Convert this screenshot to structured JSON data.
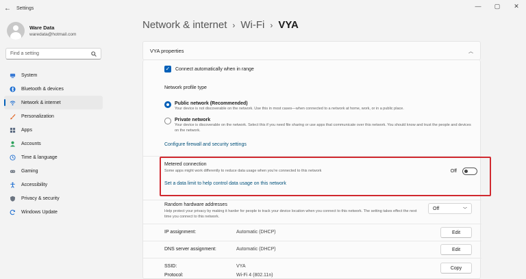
{
  "window": {
    "title": "Settings",
    "back_glyph": "←",
    "minimize": "—",
    "maximize": "▢",
    "close": "✕"
  },
  "profile": {
    "name": "Ware Data",
    "email": "waredata@hotmail.com"
  },
  "search": {
    "placeholder": "Find a setting"
  },
  "sidebar": {
    "items": [
      {
        "label": "System",
        "icon": "system-icon",
        "color": "#3a7bd5"
      },
      {
        "label": "Bluetooth & devices",
        "icon": "bluetooth-icon",
        "color": "#1f6fd1"
      },
      {
        "label": "Network & internet",
        "icon": "wifi-icon",
        "color": "#1f6fd1",
        "active": true
      },
      {
        "label": "Personalization",
        "icon": "brush-icon",
        "color": "#e36b2c"
      },
      {
        "label": "Apps",
        "icon": "apps-icon",
        "color": "#5d6c82"
      },
      {
        "label": "Accounts",
        "icon": "accounts-icon",
        "color": "#2aa05a"
      },
      {
        "label": "Time & language",
        "icon": "globe-clock-icon",
        "color": "#1f6fd1"
      },
      {
        "label": "Gaming",
        "icon": "gamepad-icon",
        "color": "#6b7480"
      },
      {
        "label": "Accessibility",
        "icon": "accessibility-icon",
        "color": "#1f6fd1"
      },
      {
        "label": "Privacy & security",
        "icon": "shield-icon",
        "color": "#6b7480"
      },
      {
        "label": "Windows Update",
        "icon": "update-icon",
        "color": "#1f6fd1"
      }
    ]
  },
  "breadcrumb": {
    "part1": "Network & internet",
    "sep": "›",
    "part2": "Wi-Fi",
    "current": "VYA"
  },
  "properties": {
    "header": "VYA properties",
    "auto_connect": "Connect automatically when in range",
    "profile_type_label": "Network profile type",
    "public_title": "Public network (Recommended)",
    "public_desc": "Your device is not discoverable on the network. Use this in most cases—when connected to a network at home, work, or in a public place.",
    "private_title": "Private network",
    "private_desc": "Your device is discoverable on the network. Select this if you need file sharing or use apps that communicate over this network. You should know and trust the people and devices on the network.",
    "firewall_link": "Configure firewall and security settings",
    "metered_title": "Metered connection",
    "metered_desc": "Some apps might work differently to reduce data usage when you're connected to this network",
    "metered_state": "Off",
    "data_limit_link": "Set a data limit to help control data usage on this network",
    "random_hw_title": "Random hardware addresses",
    "random_hw_desc": "Help protect your privacy by making it harder for people to track your device location when you connect to this network. The setting takes effect the next time you connect to this network.",
    "random_hw_value": "Off",
    "ip_label": "IP assignment:",
    "ip_value": "Automatic (DHCP)",
    "dns_label": "DNS server assignment:",
    "dns_value": "Automatic (DHCP)",
    "edit_label": "Edit",
    "ssid_label": "SSID:",
    "ssid_value": "VYA",
    "protocol_label": "Protocol:",
    "protocol_value": "Wi-Fi 4 (802.11n)",
    "copy_label": "Copy"
  },
  "colors": {
    "accent": "#005fb8",
    "highlight": "#d0282e"
  }
}
